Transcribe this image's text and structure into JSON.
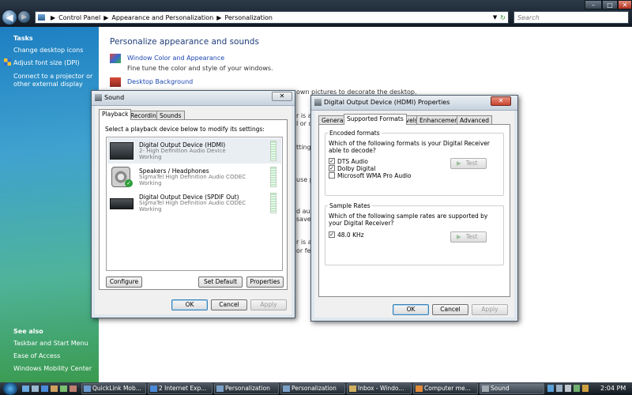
{
  "explorer": {
    "back_icon": "back-arrow-icon",
    "forward_icon": "forward-arrow-icon",
    "breadcrumbs": [
      "Control Panel",
      "Appearance and Personalization",
      "Personalization"
    ],
    "search_placeholder": "Search"
  },
  "sidebar": {
    "tasks_heading": "Tasks",
    "tasks": [
      "Change desktop icons",
      "Adjust font size (DPI)",
      "Connect to a projector or other external display"
    ],
    "see_also_heading": "See also",
    "see_also": [
      "Taskbar and Start Menu",
      "Ease of Access",
      "Windows Mobility Center"
    ]
  },
  "main": {
    "heading": "Personalize appearance and sounds",
    "items": [
      {
        "title": "Window Color and Appearance",
        "desc": "Fine tune the color and style of your windows."
      },
      {
        "title": "Desktop Background",
        "desc": "own pictures to decorate the desktop."
      }
    ],
    "partial_texts": [
      "r is a",
      "l or d",
      "tting",
      "use p",
      "d audi",
      "savers,",
      "r is a",
      "or fev"
    ]
  },
  "sound_dialog": {
    "title": "Sound",
    "tabs": [
      "Playback",
      "Recording",
      "Sounds"
    ],
    "instruction": "Select a playback device below to modify its settings:",
    "devices": [
      {
        "name": "Digital Output Device (HDMI)",
        "driver": "2- High Definition Audio Device",
        "status": "Working"
      },
      {
        "name": "Speakers / Headphones",
        "driver": "SigmaTel High Definition Audio CODEC",
        "status": "Working"
      },
      {
        "name": "Digital Output Device (SPDIF Out)",
        "driver": "SigmaTel High Definition Audio CODEC",
        "status": "Working"
      }
    ],
    "buttons": {
      "configure": "Configure",
      "set_default": "Set Default",
      "properties": "Properties",
      "ok": "OK",
      "cancel": "Cancel",
      "apply": "Apply"
    }
  },
  "props_dialog": {
    "title": "Digital Output Device (HDMI) Properties",
    "tabs": [
      "General",
      "Supported Formats",
      "Levels",
      "Enhancements",
      "Advanced"
    ],
    "encoded": {
      "label": "Encoded formats",
      "question": "Which of the following formats is your Digital Receiver able to decode?",
      "formats": [
        {
          "name": "DTS Audio",
          "checked": true
        },
        {
          "name": "Dolby Digital",
          "checked": true
        },
        {
          "name": "Microsoft WMA Pro Audio",
          "checked": false
        }
      ],
      "test_label": "Test"
    },
    "rates": {
      "label": "Sample Rates",
      "question": "Which of the following sample rates are supported by your Digital Receiver?",
      "items": [
        {
          "name": "48.0 KHz",
          "checked": true
        }
      ],
      "test_label": "Test"
    },
    "buttons": {
      "ok": "OK",
      "cancel": "Cancel",
      "apply": "Apply"
    }
  },
  "taskbar": {
    "tasks": [
      "QuickLink Mob...",
      "2 Internet Exp...",
      "Personalization",
      "Personalization",
      "Inbox - Windo...",
      "Computer me...",
      "Sound"
    ],
    "clock": "2:04 PM"
  },
  "colors": {
    "link": "#1c47b0",
    "sidebar_top": "#1d7fc2",
    "sidebar_bottom": "#3a9a4e",
    "close": "#c8442f"
  }
}
